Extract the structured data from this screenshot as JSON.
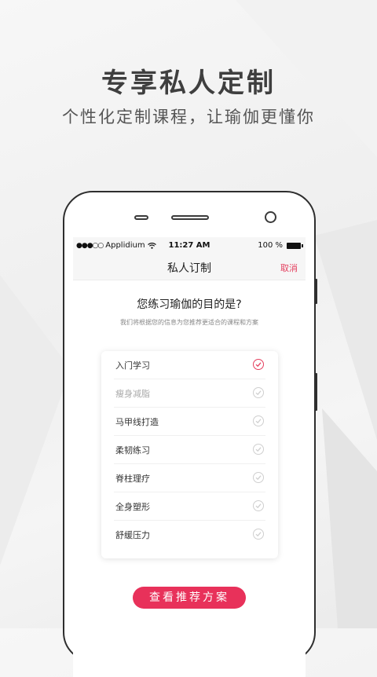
{
  "promo": {
    "headline": "专享私人定制",
    "subline": "个性化定制课程，让瑜伽更懂你"
  },
  "status_bar": {
    "signal": "●●●○○",
    "carrier": "Applidium",
    "time": "11:27 AM",
    "battery": "100 %"
  },
  "nav": {
    "title": "私人订制",
    "cancel": "取消"
  },
  "content": {
    "question": "您练习瑜伽的目的是?",
    "hint": "我们将根据您的信息为您推荐更适合的课程和方案"
  },
  "options": [
    {
      "label": "入门学习",
      "selected": true
    },
    {
      "label": "瘦身减脂",
      "selected": false
    },
    {
      "label": "马甲线打造",
      "selected": false
    },
    {
      "label": "柔韧练习",
      "selected": false
    },
    {
      "label": "脊柱理疗",
      "selected": false
    },
    {
      "label": "全身塑形",
      "selected": false
    },
    {
      "label": "舒缓压力",
      "selected": false
    }
  ],
  "cta": {
    "label": "查看推荐方案"
  },
  "colors": {
    "accent": "#e8315a",
    "cancel": "#e43f5e"
  }
}
